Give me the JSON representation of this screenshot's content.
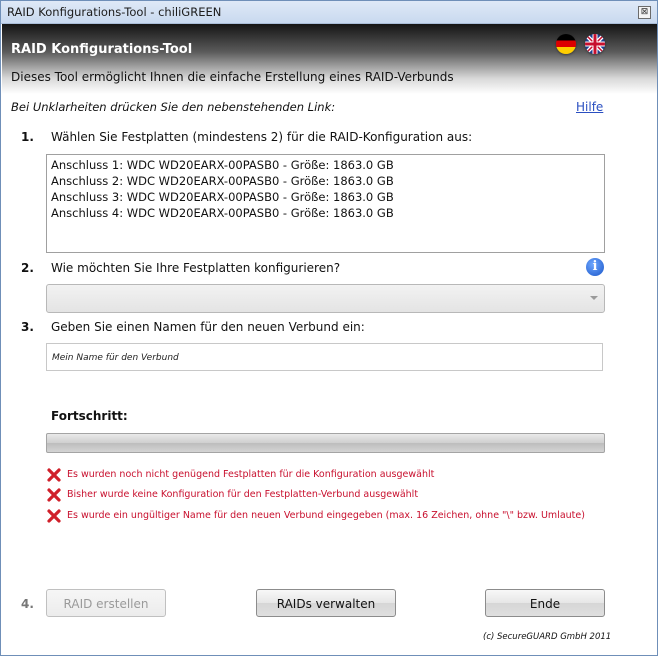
{
  "window": {
    "title": "RAID Konfigurations-Tool - chiliGREEN",
    "close_glyph": "⊠"
  },
  "header": {
    "title": "RAID Konfigurations-Tool",
    "subtitle": "Dieses Tool ermöglicht Ihnen die einfache Erstellung eines RAID-Verbunds",
    "flags": [
      "german-flag-icon",
      "uk-flag-icon"
    ]
  },
  "help": {
    "hint": "Bei Unklarheiten drücken Sie den nebenstehenden Link:",
    "link_label": "Hilfe"
  },
  "steps": {
    "step1": {
      "number": "1.",
      "label": "Wählen Sie Festplatten (mindestens 2) für die RAID-Konfiguration aus:"
    },
    "step2": {
      "number": "2.",
      "label": "Wie möchten Sie Ihre Festplatten konfigurieren?"
    },
    "step3": {
      "number": "3.",
      "label": "Geben Sie einen Namen für den neuen Verbund ein:"
    },
    "step4": {
      "number": "4."
    }
  },
  "disks": [
    "Anschluss 1: WDC WD20EARX-00PASB0 - Größe: 1863.0 GB",
    "Anschluss 2: WDC WD20EARX-00PASB0 - Größe: 1863.0 GB",
    "Anschluss 3: WDC WD20EARX-00PASB0 - Größe: 1863.0 GB",
    "Anschluss 4: WDC WD20EARX-00PASB0 - Größe: 1863.0 GB"
  ],
  "config_select": {
    "value": ""
  },
  "name_input": {
    "value": "Mein Name für den Verbund"
  },
  "progress": {
    "label": "Fortschritt:",
    "value": 0
  },
  "errors": [
    "Es wurden noch nicht genügend Festplatten für die Konfiguration ausgewählt",
    "Bisher wurde keine Konfiguration für den Festplatten-Verbund ausgewählt",
    "Es wurde ein ungültiger Name für den neuen Verbund eingegeben (max. 16 Zeichen, ohne \"\\\" bzw. Umlaute)"
  ],
  "buttons": {
    "create": "RAID erstellen",
    "manage": "RAIDs verwalten",
    "exit": "Ende"
  },
  "footer": {
    "copyright": "(c) SecureGUARD GmbH 2011"
  },
  "colors": {
    "error": "#c8102e",
    "link": "#2a4fc1",
    "info": "#1a56c9"
  }
}
